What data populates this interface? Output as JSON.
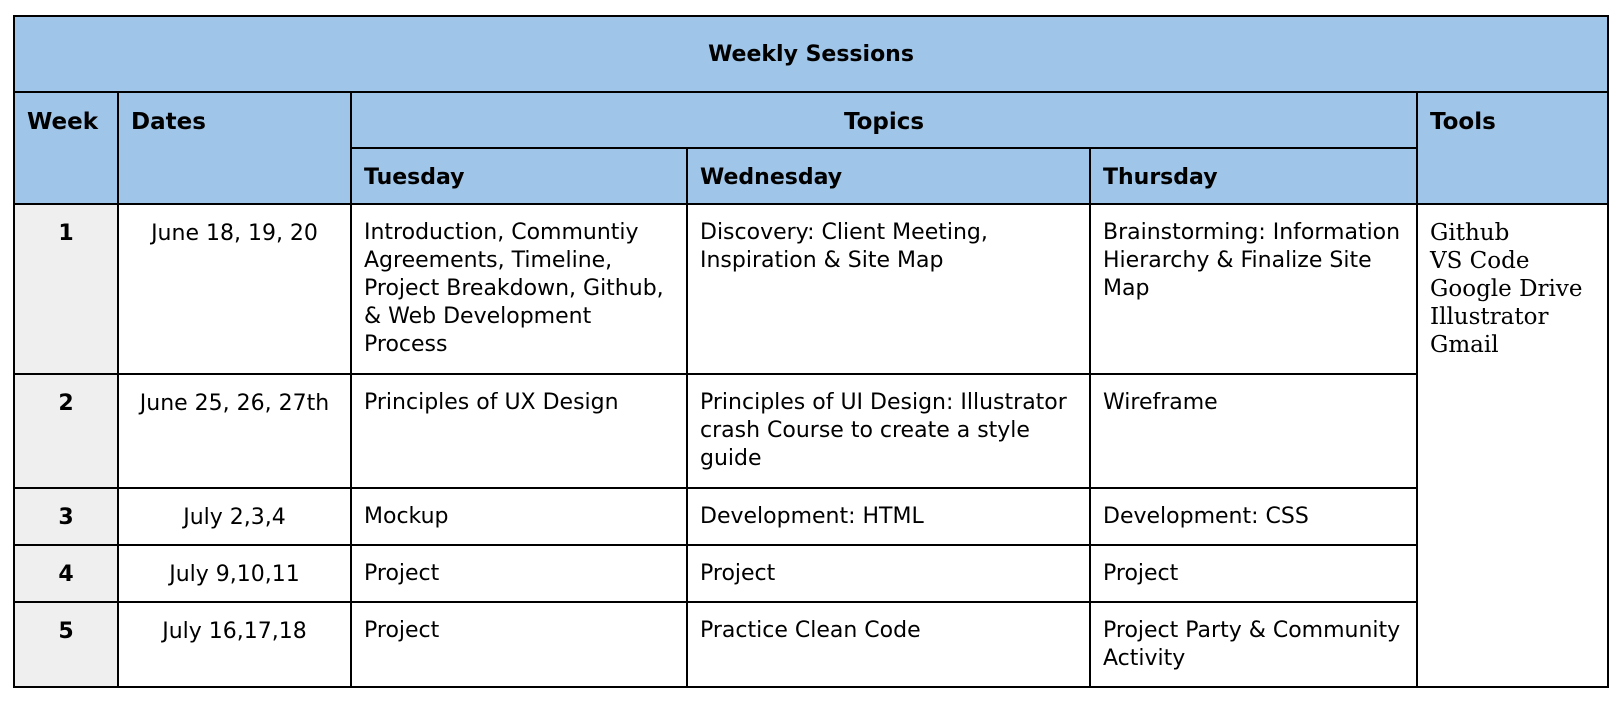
{
  "table": {
    "title": "Weekly Sessions",
    "headers": {
      "week": "Week",
      "dates": "Dates",
      "topics": "Topics",
      "tools": "Tools",
      "days": [
        "Tuesday",
        "Wednesday",
        "Thursday"
      ]
    },
    "rows": [
      {
        "week": "1",
        "dates": "June 18, 19,  20",
        "tuesday": "Introduction, Communtiy Agreements, Timeline, Project Breakdown, Github, & Web Development Process",
        "wednesday": "Discovery: Client Meeting, Inspiration &  Site Map",
        "thursday": "Brainstorming: Information Hierarchy  & Finalize Site Map"
      },
      {
        "week": "2",
        "dates": "June 25, 26, 27th",
        "tuesday": "Principles of UX Design",
        "wednesday": "Principles of UI Design: Illustrator crash Course to create a style guide",
        "thursday": "Wireframe"
      },
      {
        "week": "3",
        "dates": "July 2,3,4",
        "tuesday": "Mockup",
        "wednesday": "Development: HTML",
        "thursday": "Development: CSS"
      },
      {
        "week": "4",
        "dates": "July 9,10,11",
        "tuesday": "Project",
        "wednesday": "Project",
        "thursday": "Project"
      },
      {
        "week": "5",
        "dates": "July 16,17,18",
        "tuesday": "Project",
        "wednesday": "Practice Clean Code",
        "thursday": "Project Party  & Community Activity"
      }
    ],
    "tools": [
      "Github",
      "VS Code",
      "Google Drive",
      "Illustrator",
      "Gmail"
    ]
  },
  "colors": {
    "header_bg": "#9fc5e8",
    "week_col_bg": "#efefef",
    "border": "#000000"
  }
}
